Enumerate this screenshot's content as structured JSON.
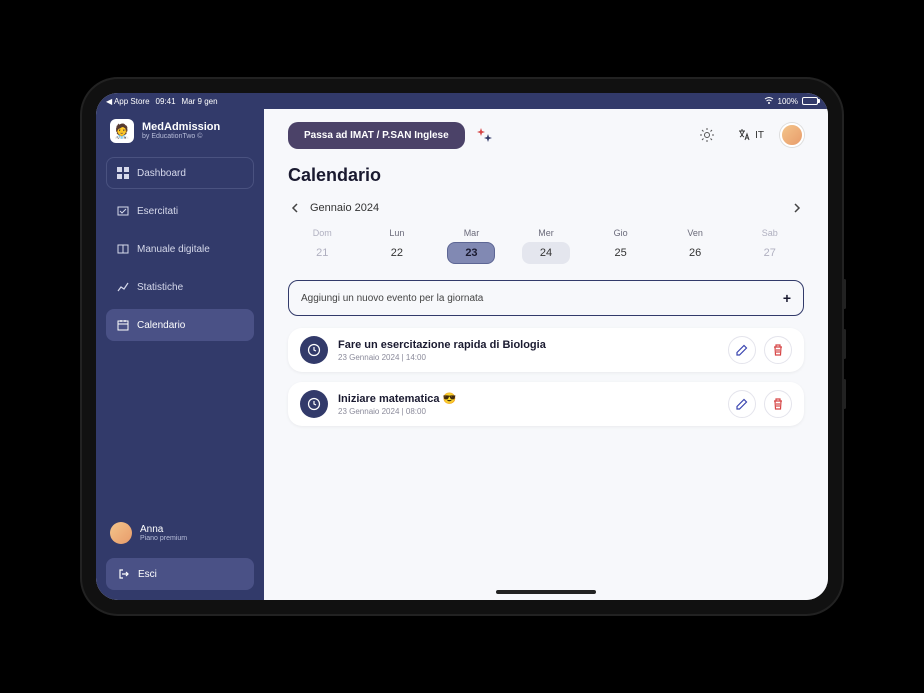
{
  "status": {
    "back": "App Store",
    "time": "09:41",
    "date": "Mar 9 gen",
    "battery_pct": "100%"
  },
  "brand": {
    "name": "MedAdmission",
    "sub": "by EducationTwo ©"
  },
  "nav": {
    "items": [
      {
        "label": "Dashboard",
        "icon": "dashboard"
      },
      {
        "label": "Esercitati",
        "icon": "practice"
      },
      {
        "label": "Manuale digitale",
        "icon": "book"
      },
      {
        "label": "Statistiche",
        "icon": "stats"
      },
      {
        "label": "Calendario",
        "icon": "calendar"
      }
    ]
  },
  "user": {
    "name": "Anna",
    "plan": "Piano premium"
  },
  "logout_label": "Esci",
  "topbar": {
    "cta": "Passa ad IMAT / P.SAN Inglese",
    "lang": "IT"
  },
  "page": {
    "title": "Calendario",
    "month": "Gennaio 2024",
    "add_event_placeholder": "Aggiungi un nuovo evento per la giornata",
    "days": [
      {
        "label": "Dom",
        "num": "21",
        "state": "dim"
      },
      {
        "label": "Lun",
        "num": "22",
        "state": ""
      },
      {
        "label": "Mar",
        "num": "23",
        "state": "selected"
      },
      {
        "label": "Mer",
        "num": "24",
        "state": "today"
      },
      {
        "label": "Gio",
        "num": "25",
        "state": ""
      },
      {
        "label": "Ven",
        "num": "26",
        "state": ""
      },
      {
        "label": "Sab",
        "num": "27",
        "state": "dim"
      }
    ],
    "events": [
      {
        "title": "Fare un esercitazione rapida di Biologia",
        "meta": "23 Gennaio 2024  |  14:00"
      },
      {
        "title": "Iniziare matematica 😎",
        "meta": "23 Gennaio 2024  |  08:00"
      }
    ]
  }
}
